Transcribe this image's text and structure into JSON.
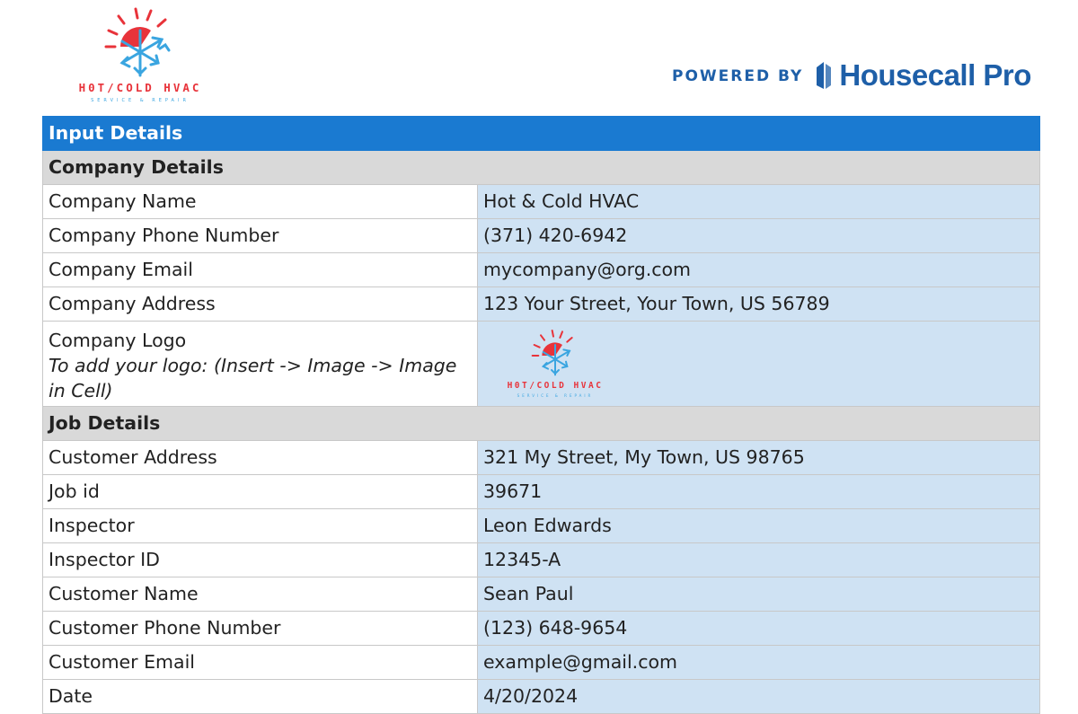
{
  "company_logo": {
    "name": "H0T/COLD HVAC",
    "tagline": "SERVICE & REPAIR",
    "colors": {
      "sun": "#e8333a",
      "snowflake": "#3aa5e0"
    },
    "icon": "sun-snowflake-logo"
  },
  "powered_by": {
    "prefix": "POWERED BY",
    "brand": "Housecall Pro",
    "icon": "housecall-pro-icon",
    "color": "#1e5fa8"
  },
  "sheet": {
    "title": "Input Details",
    "company_section": {
      "heading": "Company Details",
      "rows": [
        {
          "label": "Company Name",
          "value": "Hot & Cold HVAC"
        },
        {
          "label": "Company Phone Number",
          "value": "(371) 420-6942"
        },
        {
          "label": "Company Email",
          "value": "mycompany@org.com"
        },
        {
          "label": "Company Address",
          "value": "123 Your Street, Your Town, US 56789"
        }
      ],
      "logo_row": {
        "label": "Company Logo",
        "hint": "To add your logo: (Insert -> Image -> Image in Cell)"
      }
    },
    "job_section": {
      "heading": "Job Details",
      "rows": [
        {
          "label": "Customer Address",
          "value": "321 My Street, My Town, US 98765"
        },
        {
          "label": "Job id",
          "value": "39671"
        },
        {
          "label": "Inspector",
          "value": "Leon Edwards"
        },
        {
          "label": "Inspector ID",
          "value": "12345-A"
        },
        {
          "label": "Customer Name",
          "value": "Sean Paul"
        },
        {
          "label": "Customer Phone Number",
          "value": "(123) 648-9654"
        },
        {
          "label": "Customer Email",
          "value": "example@gmail.com"
        },
        {
          "label": "Date",
          "value": "4/20/2024"
        }
      ]
    },
    "colors": {
      "title_bg": "#1a7ad1",
      "section_bg": "#d9d9d9",
      "value_bg": "#cfe2f3"
    }
  }
}
